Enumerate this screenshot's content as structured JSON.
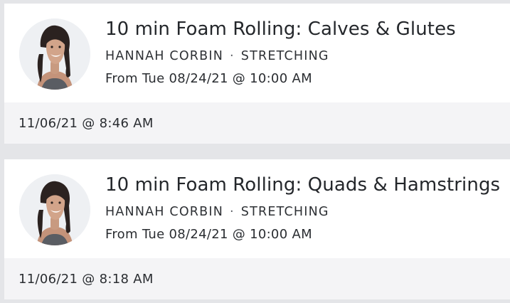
{
  "classes": [
    {
      "title": "10 min Foam Rolling: Calves & Glutes",
      "instructor": "HANNAH CORBIN",
      "separator": "·",
      "category": "STRETCHING",
      "schedule": "From Tue 08/24/21 @ 10:00 AM",
      "taken_at": "11/06/21 @ 8:46 AM"
    },
    {
      "title": "10 min Foam Rolling: Quads & Hamstrings",
      "instructor": "HANNAH CORBIN",
      "separator": "·",
      "category": "STRETCHING",
      "schedule": "From Tue 08/24/21 @ 10:00 AM",
      "taken_at": "11/06/21 @ 8:18 AM"
    }
  ],
  "colors": {
    "background": "#e4e5e8",
    "card": "#ffffff",
    "footer": "#f4f4f6",
    "text": "#24272b"
  },
  "icons": {
    "avatar": "instructor-avatar"
  }
}
